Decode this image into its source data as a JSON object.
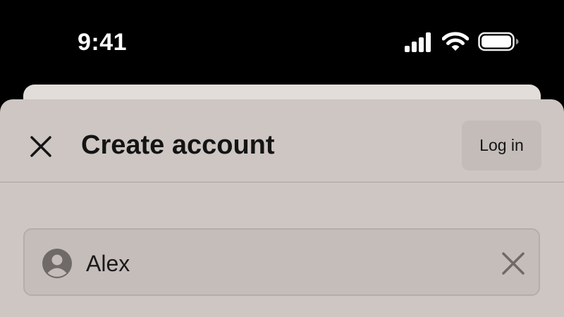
{
  "status_bar": {
    "time": "9:41",
    "icons": [
      "cellular-signal-icon",
      "wifi-icon",
      "battery-icon"
    ]
  },
  "sheet": {
    "title": "Create account",
    "close_icon": "close-icon",
    "login_label": "Log in"
  },
  "name_field": {
    "value": "Alex",
    "leading_icon": "person-icon",
    "clear_icon": "clear-icon"
  },
  "colors": {
    "status_background": "#000000",
    "sheet_background": "#cdc6c3",
    "back_sheet_background": "#e2ddd9",
    "button_background": "#c3bcb9",
    "field_background": "#c4bdba",
    "text_primary": "#141414"
  }
}
